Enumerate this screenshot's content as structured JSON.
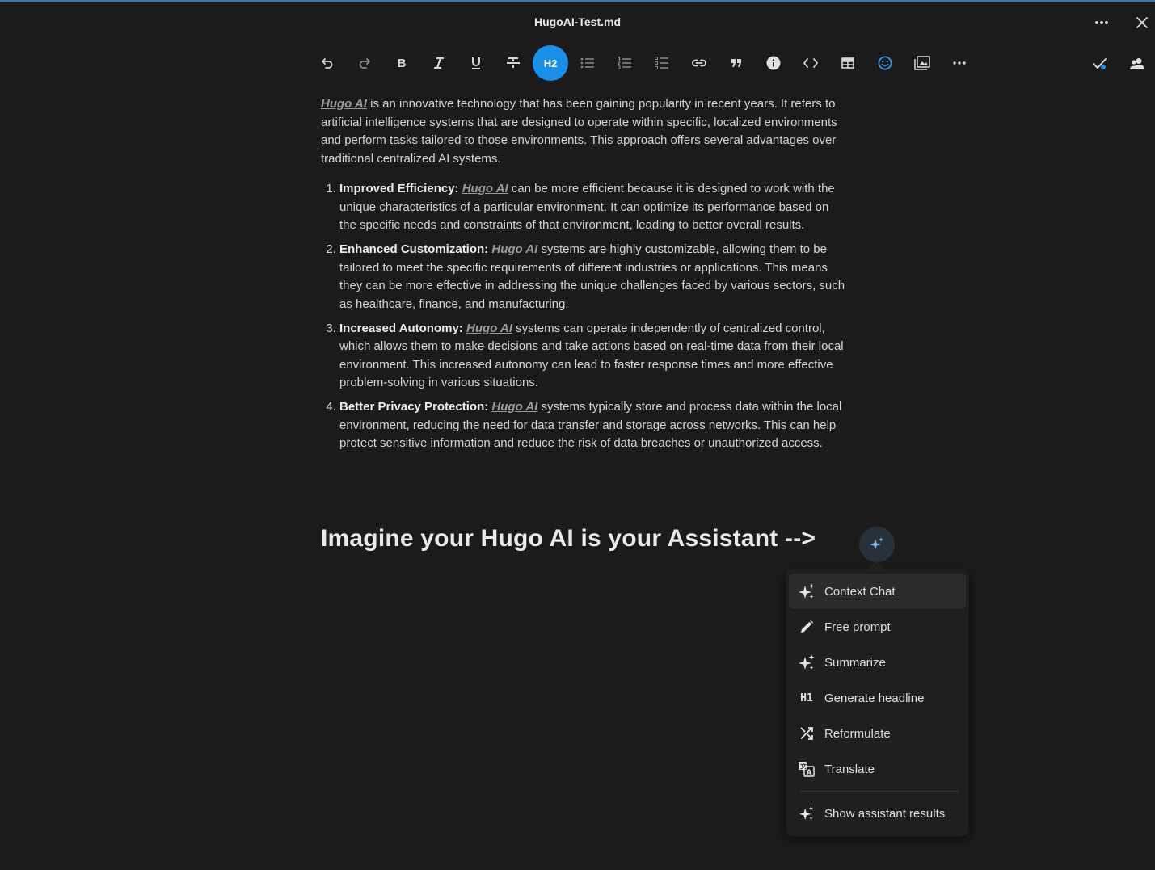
{
  "window": {
    "title": "HugoAI-Test.md"
  },
  "toolbar": {
    "heading_label": "H2",
    "items": [
      {
        "name": "undo-icon"
      },
      {
        "name": "redo-icon"
      },
      {
        "name": "bold-icon",
        "label": "B"
      },
      {
        "name": "italic-icon"
      },
      {
        "name": "underline-icon"
      },
      {
        "name": "strikethrough-icon"
      },
      {
        "name": "heading-2",
        "label": "H2",
        "active": true
      },
      {
        "name": "bullet-list-icon"
      },
      {
        "name": "numbered-list-icon"
      },
      {
        "name": "checklist-icon"
      },
      {
        "name": "link-icon"
      },
      {
        "name": "quote-icon"
      },
      {
        "name": "info-icon"
      },
      {
        "name": "code-icon"
      },
      {
        "name": "table-icon"
      },
      {
        "name": "emoji-icon"
      },
      {
        "name": "image-gallery-icon"
      },
      {
        "name": "more-icon"
      }
    ],
    "accent_color": "#1a8fe8"
  },
  "document": {
    "intro": {
      "link": "Hugo AI",
      "text": " is an innovative technology that has been gaining popularity in recent years. It refers to artificial intelligence systems that are designed to operate within specific, localized environments and perform tasks tailored to those environments. This approach offers several advantages over traditional centralized AI systems."
    },
    "features": [
      {
        "title": "Improved Efficiency:",
        "link": "Hugo AI",
        "text": " can be more efficient because it is designed to work with the unique characteristics of a particular environment. It can optimize its performance based on the specific needs and constraints of that environment, leading to better overall results."
      },
      {
        "title": "Enhanced Customization:",
        "link": "Hugo AI",
        "text": " systems are highly customizable, allowing them to be tailored to meet the specific requirements of different industries or applications. This means they can be more effective in addressing the unique challenges faced by various sectors, such as healthcare, finance, and manufacturing."
      },
      {
        "title": "Increased Autonomy:",
        "link": "Hugo AI",
        "text": " systems can operate independently of centralized control, which allows them to make decisions and take actions based on real-time data from their local environment. This increased autonomy can lead to faster response times and more effective problem-solving in various situations."
      },
      {
        "title": "Better Privacy Protection:",
        "link": "Hugo AI",
        "text": " systems typically store and process data within the local environment, reducing the need for data transfer and storage across networks. This can help protect sensitive information and reduce the risk of data breaches or unauthorized access."
      }
    ],
    "heading": "Imagine your Hugo AI is your Assistant -->"
  },
  "ai_menu": {
    "items": [
      {
        "label": "Context Chat",
        "icon": "sparkles-icon",
        "highlighted": true
      },
      {
        "label": "Free prompt",
        "icon": "pencil-icon"
      },
      {
        "label": "Summarize",
        "icon": "sparkles-icon"
      },
      {
        "label": "Generate headline",
        "icon": "h1-icon",
        "icon_text": "H1"
      },
      {
        "label": "Reformulate",
        "icon": "shuffle-icon"
      },
      {
        "label": "Translate",
        "icon": "translate-icon"
      }
    ],
    "footer_item": {
      "label": "Show assistant results",
      "icon": "sparkles-icon"
    },
    "trigger_icon_color": "#7fb6e8"
  }
}
